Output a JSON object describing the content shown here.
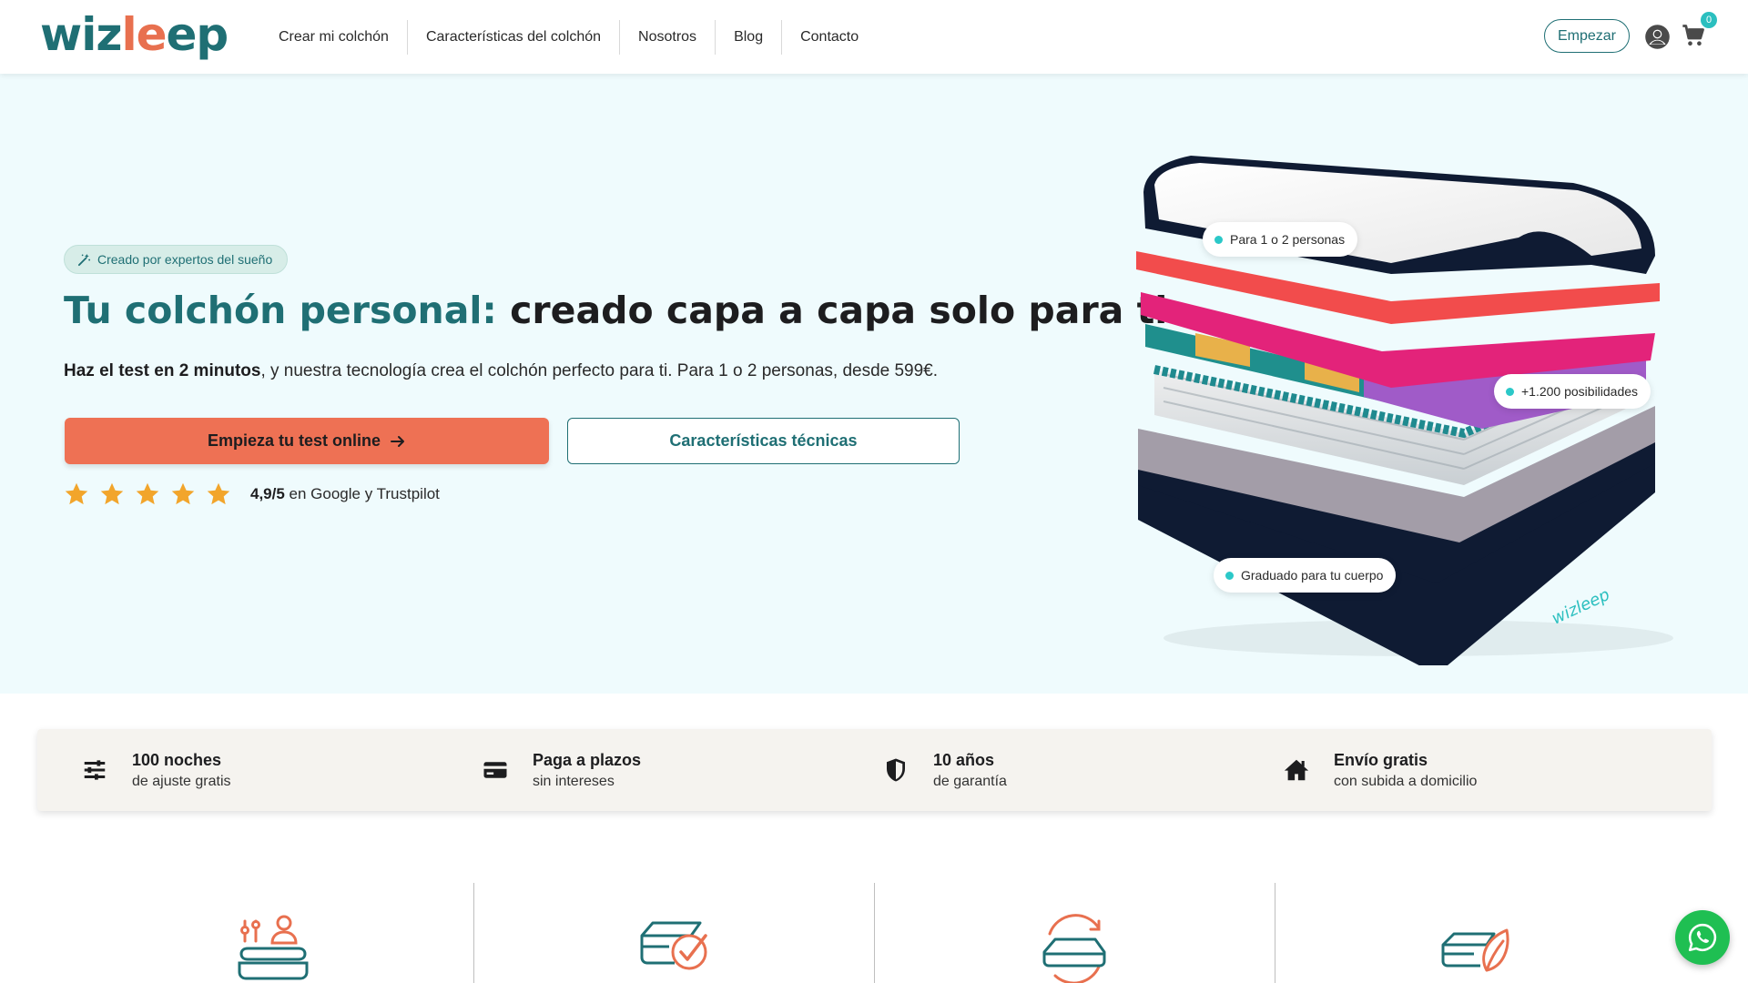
{
  "brand": {
    "logo_text_a": "wiz",
    "logo_text_b": "le",
    "logo_text_c": "ep",
    "colors": {
      "primary": "#1f6f74",
      "accent": "#ee7154",
      "hero_bg": "#effbfd",
      "badge": "#2bbfbf"
    }
  },
  "nav": {
    "items": [
      {
        "label": "Crear mi colchón"
      },
      {
        "label": "Características del colchón"
      },
      {
        "label": "Nosotros"
      },
      {
        "label": "Blog"
      },
      {
        "label": "Contacto"
      }
    ],
    "cta_label": "Empezar",
    "user_icon": "user-circle-icon",
    "cart_icon": "cart-icon",
    "cart_count": "0"
  },
  "hero": {
    "tag": "Creado por expertos del sueño",
    "headline_accent": "Tu colchón personal:",
    "headline_rest": "creado capa a capa solo para ti",
    "sub_bold": "Haz el test en 2 minutos",
    "sub_rest": ", y nuestra tecnología crea el colchón perfecto para ti. Para 1 o 2 personas, desde 599€.",
    "primary_button": "Empieza tu test online",
    "secondary_button": "Características técnicas",
    "rating_value": "4,9/5",
    "rating_text": " en Google y Trustpilot",
    "stars": 5,
    "image_labels": [
      "Para 1 o 2 personas",
      "+1.200 posibilidades",
      "Graduado para tu cuerpo"
    ],
    "mattress_brand_mark": "wizleep"
  },
  "benefits": [
    {
      "icon": "sliders-icon",
      "title": "100 noches",
      "subtitle": "de ajuste gratis"
    },
    {
      "icon": "credit-card-icon",
      "title": "Paga a plazos",
      "subtitle": "sin intereses"
    },
    {
      "icon": "shield-icon",
      "title": "10 años",
      "subtitle": "de garantía"
    },
    {
      "icon": "home-icon",
      "title": "Envío gratis",
      "subtitle": "con subida a domicilio"
    }
  ],
  "features": [
    {
      "icon": "custom-mattress-icon"
    },
    {
      "icon": "mattress-check-icon"
    },
    {
      "icon": "mattress-refresh-icon"
    },
    {
      "icon": "mattress-leaf-icon"
    }
  ],
  "whatsapp_icon": "whatsapp-icon"
}
